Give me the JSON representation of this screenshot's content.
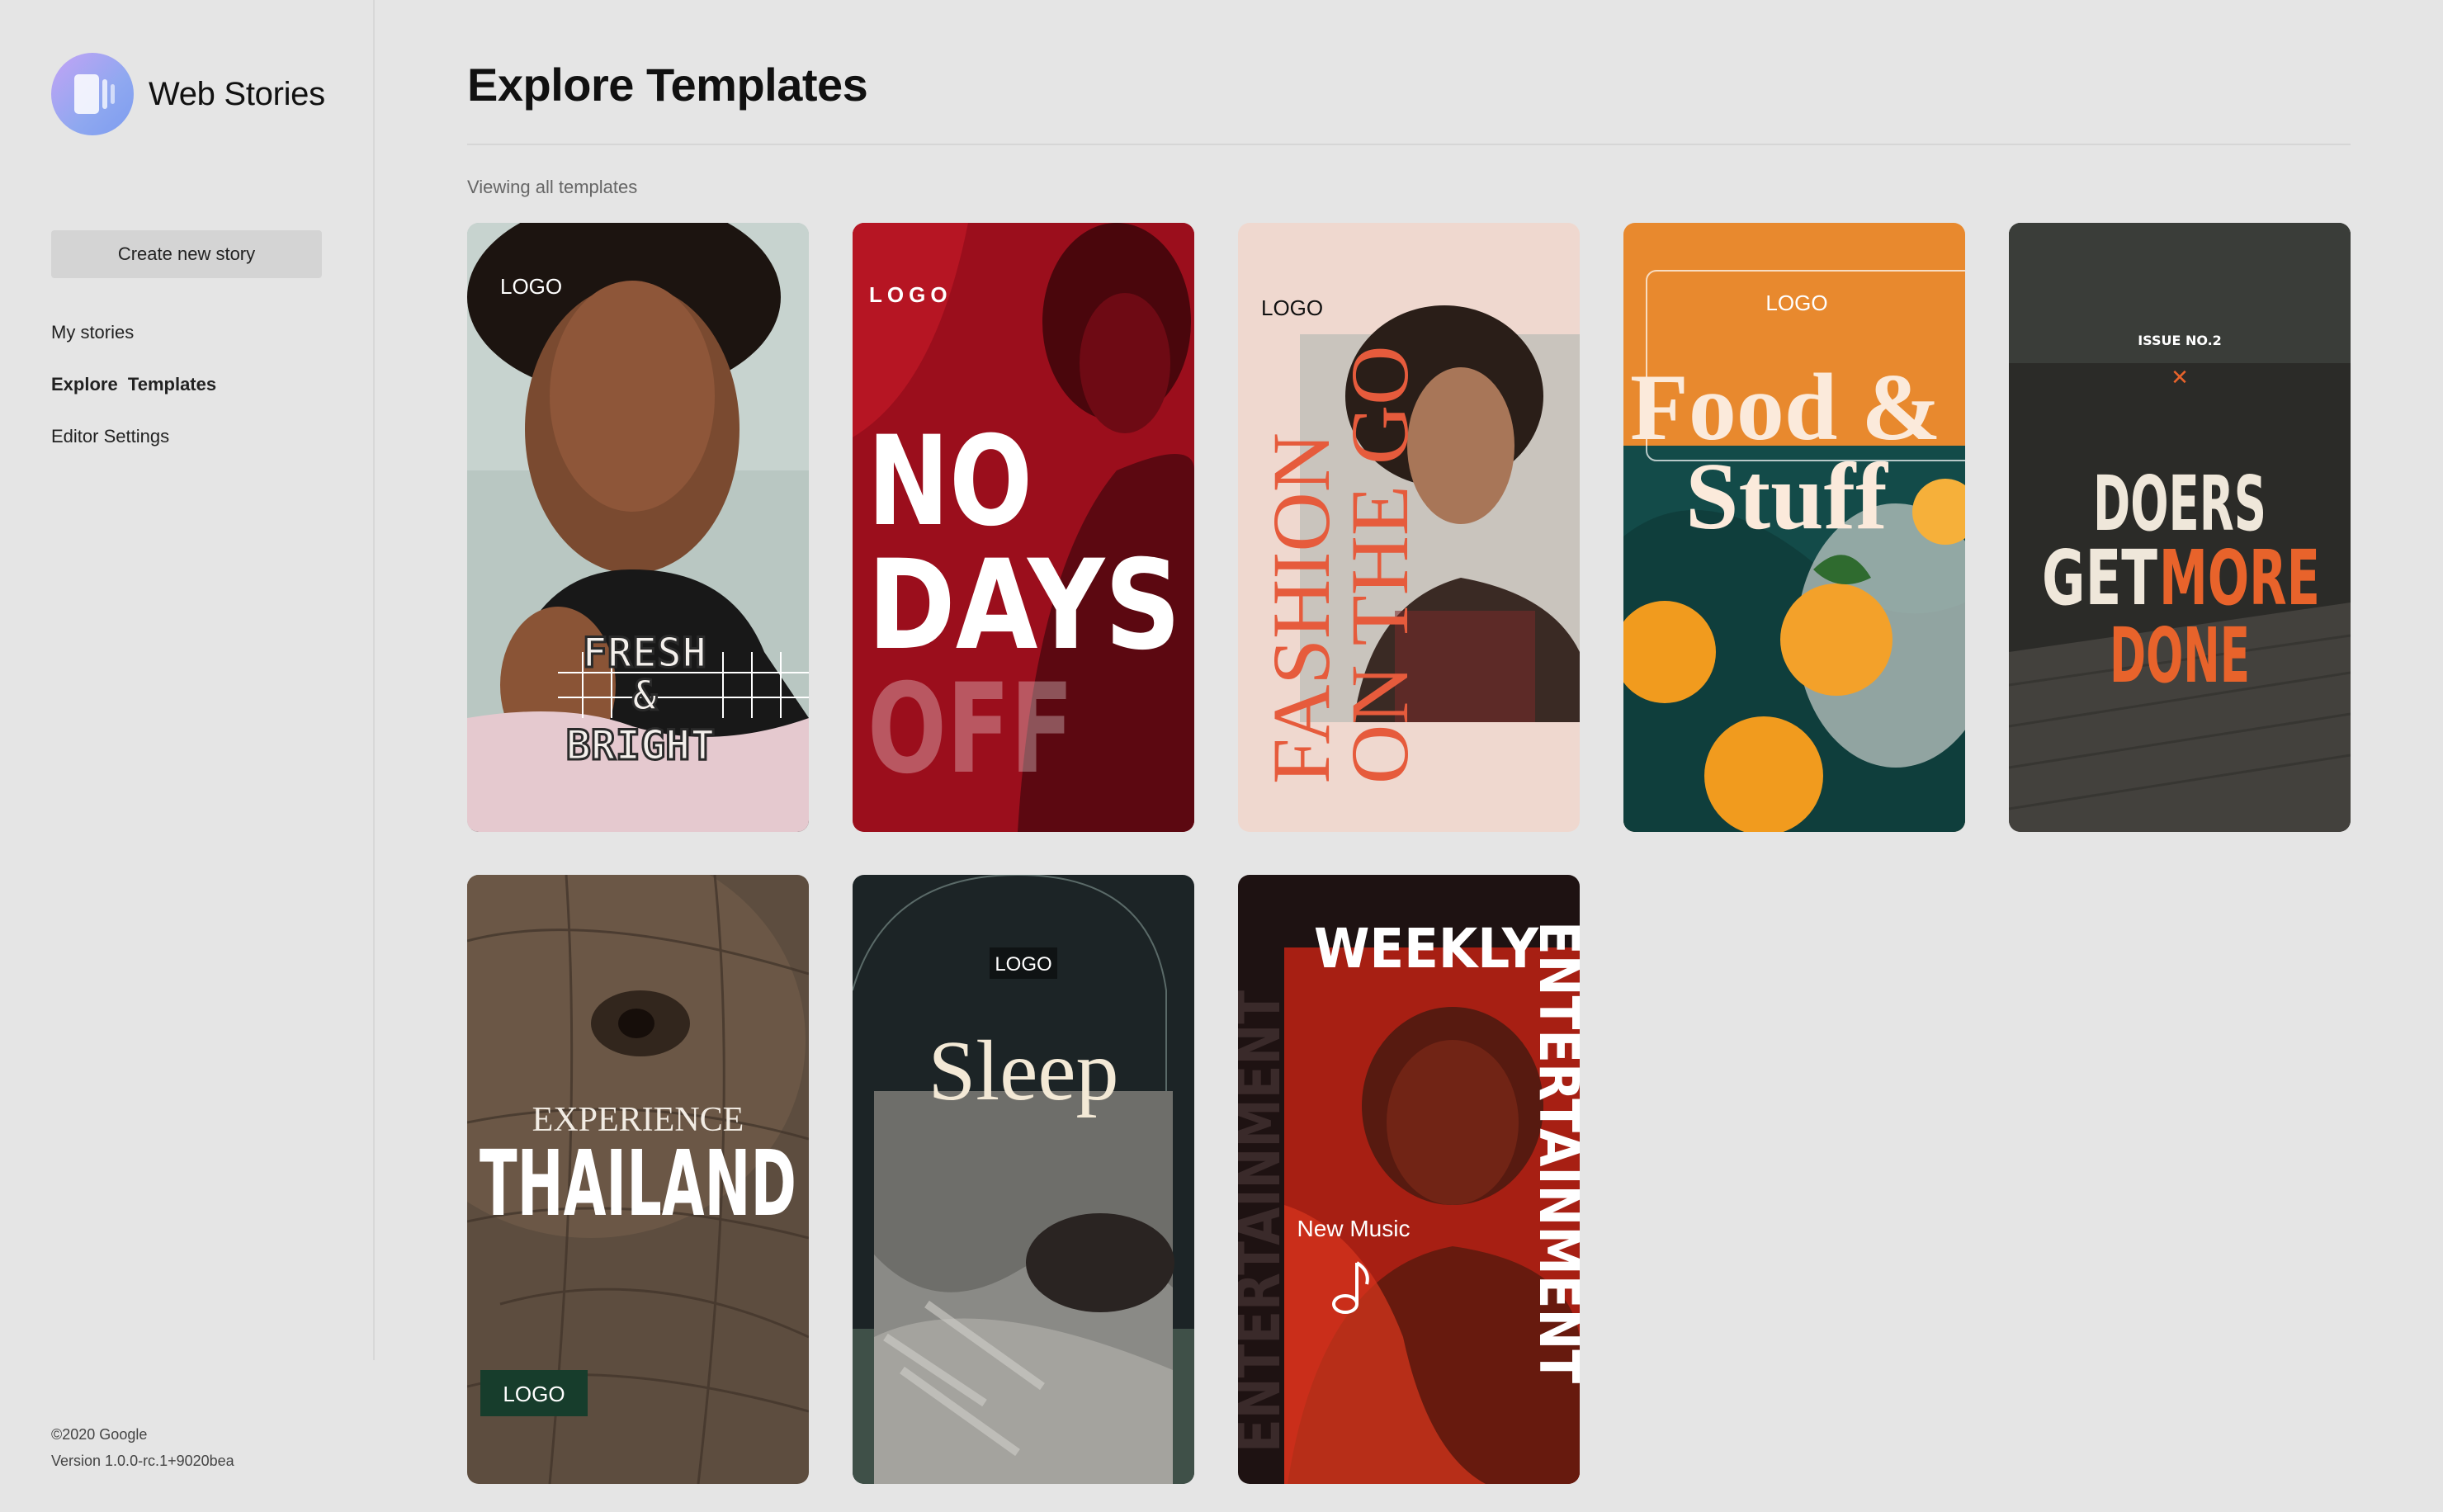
{
  "brand": {
    "name": "Web Stories",
    "logo_icon": "web-stories-logo-icon"
  },
  "sidebar": {
    "create_label": "Create new story",
    "items": [
      {
        "label": "My stories",
        "active": false
      },
      {
        "label": "Explore  Templates",
        "active": true
      },
      {
        "label": "Editor Settings",
        "active": false
      }
    ],
    "footer": {
      "copyright": "©2020 Google",
      "version": "Version 1.0.0-rc.1+9020bea"
    }
  },
  "main": {
    "title": "Explore Templates",
    "viewing_label": "Viewing all templates",
    "templates": [
      {
        "logo": "LOGO",
        "line1": "FRESH",
        "line2": "&",
        "line3": "BRIGHT"
      },
      {
        "logo": "LOGO",
        "line1": "NO",
        "line2": "DAYS",
        "line3": "OFF"
      },
      {
        "logo": "LOGO",
        "line1": "FASHION",
        "line2": "ON THE GO"
      },
      {
        "logo": "LOGO",
        "line1": "Food &",
        "line2": "Stuff"
      },
      {
        "issue": "ISSUE NO.2",
        "mark": "✕",
        "line1": "DOERS",
        "line2a": "GET ",
        "line2b": "MORE",
        "line3": "DONE"
      },
      {
        "line1": "EXPERIENCE",
        "line2": "THAILAND",
        "logo": "LOGO"
      },
      {
        "logo": "LOGO",
        "line1": "Sleep"
      },
      {
        "line1": "WEEKLY",
        "side1": "ENTERTAINMENT",
        "side2": "ENTERTAINMENT",
        "badge": "New Music",
        "badge_icon": "music-note-icon"
      }
    ]
  },
  "colors": {
    "background": "#e5e5e5",
    "accent_orange": "#e8632b",
    "button_bg": "#d4d4d4"
  }
}
